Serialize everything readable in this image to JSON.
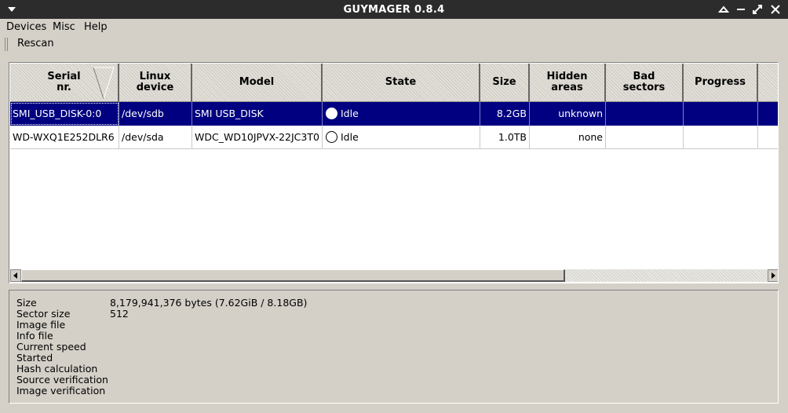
{
  "window": {
    "title": "GUYMAGER 0.8.4"
  },
  "menu": {
    "devices": "Devices",
    "misc": "Misc",
    "help": "Help"
  },
  "toolbar": {
    "rescan": "Rescan"
  },
  "table": {
    "columns": [
      "Serial\nnr.",
      "Linux\ndevice",
      "Model",
      "State",
      "Size",
      "Hidden\nareas",
      "Bad\nsectors",
      "Progress",
      ""
    ],
    "rows": [
      {
        "serial": "SMI_USB_DISK-0:0",
        "device": "/dev/sdb",
        "model": "SMI USB_DISK",
        "state": "Idle",
        "size": "8.2GB",
        "hidden": "unknown",
        "bad": "",
        "progress": "",
        "selected": true
      },
      {
        "serial": "WD-WXQ1E252DLR6",
        "device": "/dev/sda",
        "model": "WDC_WD10JPVX-22JC3T0",
        "state": "Idle",
        "size": "1.0TB",
        "hidden": "none",
        "bad": "",
        "progress": "",
        "selected": false
      }
    ]
  },
  "info": {
    "size_label": "Size",
    "size_value": "8,179,941,376 bytes (7.62GiB / 8.18GB)",
    "sector_size_label": "Sector size",
    "sector_size_value": "512",
    "image_file_label": "Image file",
    "info_file_label": "Info file",
    "current_speed_label": "Current speed",
    "started_label": "Started",
    "hash_calc_label": "Hash calculation",
    "source_verif_label": "Source verification",
    "image_verif_label": "Image verification"
  },
  "colors": {
    "selection": "#000080",
    "titlebar": "#2c2c2c",
    "window_bg": "#d4d0c8"
  }
}
